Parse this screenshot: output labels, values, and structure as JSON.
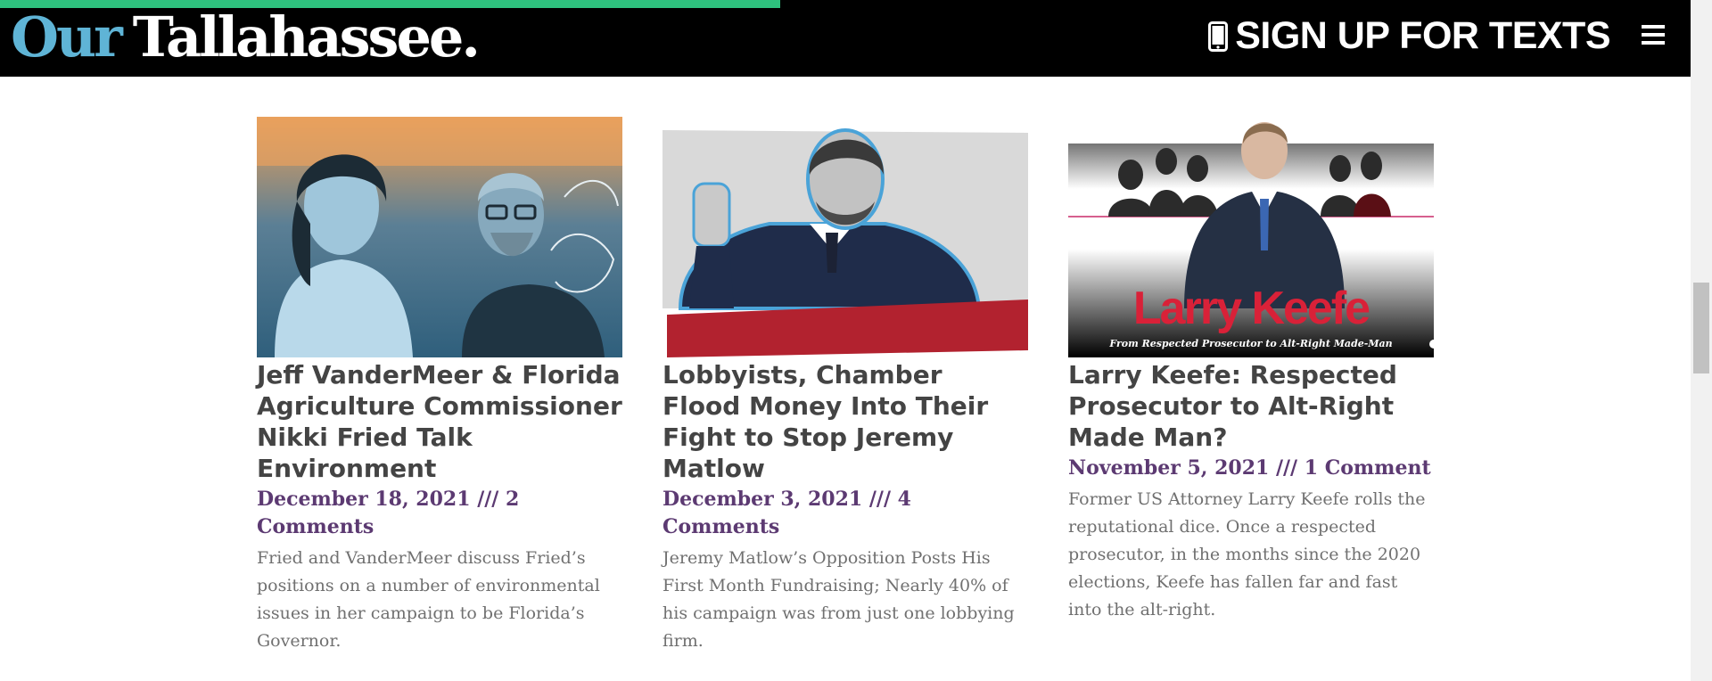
{
  "site": {
    "logo_part1": "Our",
    "logo_part2": "Tallahassee."
  },
  "header": {
    "signup_label": "SIGN UP FOR TEXTS",
    "signup_icon": "mobile-phone-icon",
    "menu_icon": "hamburger-menu-icon"
  },
  "colors": {
    "header_bg": "#000000",
    "logo_accent": "#5fb4d6",
    "progress": "#2ec27e",
    "title": "#444444",
    "meta": "#5c3a72",
    "excerpt": "#707070"
  },
  "articles": [
    {
      "title": "Jeff VanderMeer & Florida Agriculture Commissioner Nikki Fried Talk Environment",
      "meta": "December 18, 2021 /// 2 Comments",
      "excerpt": "Fried and VanderMeer discuss Fried’s positions on a number of environmental issues in her campaign to be Florida’s Governor."
    },
    {
      "title": "Lobbyists, Chamber Flood Money Into Their Fight to Stop Jeremy Matlow",
      "meta": "December 3, 2021 /// 4 Comments",
      "excerpt": "Jeremy Matlow’s Opposition Posts His First Month Fundraising; Nearly 40% of his campaign was from just one lobbying firm."
    },
    {
      "title": "Larry Keefe: Respected Prosecutor to Alt-Right Made Man?",
      "meta": "November 5, 2021 /// 1 Comment",
      "excerpt": "Former US Attorney Larry Keefe rolls the reputational dice. Once a respected prosecutor, in the months since the 2020 elections, Keefe has fallen far and fast into the alt-right.",
      "image_text_main": "Larry Keefe",
      "image_text_sub": "From Respected Prosecutor to Alt-Right Made-Man"
    }
  ]
}
